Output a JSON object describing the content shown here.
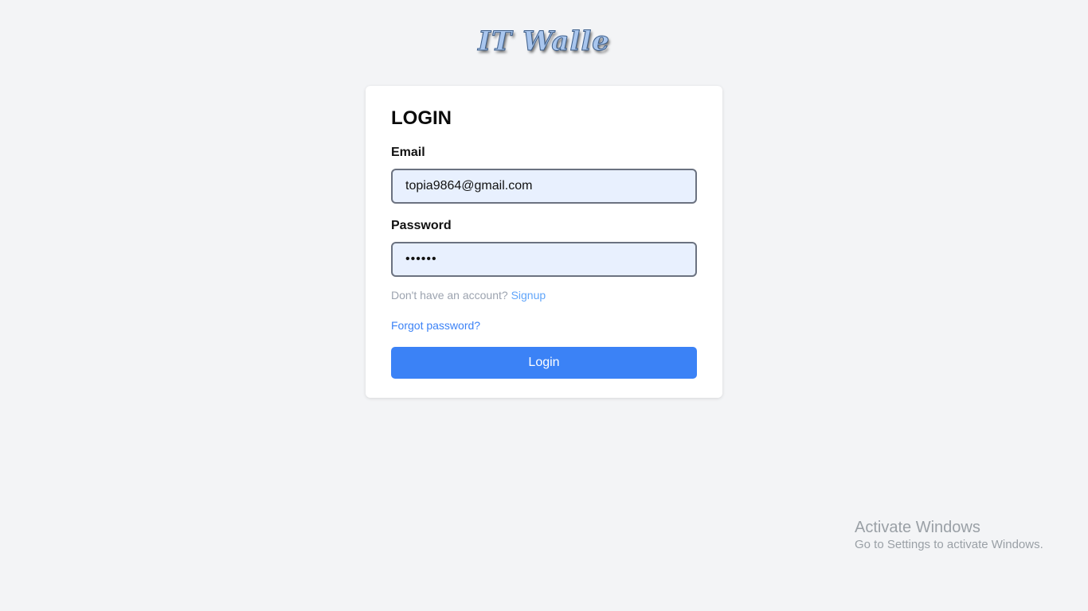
{
  "brand": {
    "logo_text": "IT Walle"
  },
  "login": {
    "title": "LOGIN",
    "email_label": "Email",
    "email_value": "topia9864@gmail.com",
    "password_label": "Password",
    "password_value": "••••••",
    "signup_prompt": "Don't have an account?",
    "signup_link": "Signup",
    "forgot_link": "Forgot password?",
    "login_button": "Login"
  },
  "watermark": {
    "title": "Activate Windows",
    "subtitle": "Go to Settings to activate Windows."
  },
  "colors": {
    "background": "#f3f4f6",
    "card": "#ffffff",
    "input_fill": "#e8f0fe",
    "input_border": "#6b7280",
    "accent": "#3b82f6",
    "link": "#60a5fa",
    "muted_text": "#9ca3af"
  }
}
